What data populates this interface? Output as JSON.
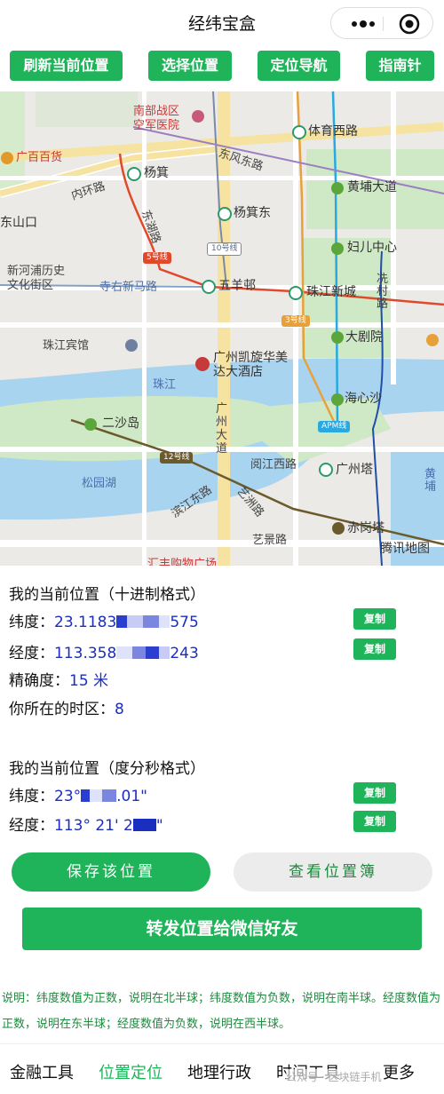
{
  "header": {
    "title": "经纬宝盒"
  },
  "top_buttons": [
    "刷新当前位置",
    "选择位置",
    "定位导航",
    "指南针"
  ],
  "map": {
    "labels": {
      "nanbu": "南部战区",
      "kongjun": "空军医院",
      "tiyu_xilu": "体育西路",
      "guangbai": "广百百货",
      "yangji": "杨箕",
      "dongfeng_donglu": "东风东路",
      "huangpu_dadao": "黄埔大道",
      "neihuanlu": "内环路",
      "dongshan": "东山口",
      "dongshan_lu": "东湖路",
      "yangjidong": "杨箕东",
      "fuer_zhongxin": "妇儿中心",
      "xinhepu": "新河浦历史",
      "wenhua_jiequ": "文化街区",
      "line5": "5号线",
      "line10": "10号线",
      "xianliu_lu": "冼村路",
      "siyou_xinmalu": "寺右新马路",
      "wuyangyi": "五羊邨",
      "zhujiang_xincheng": "珠江新城",
      "line3": "3号线",
      "zhujiang_binguan": "珠江宾馆",
      "dajuyuan": "大剧院",
      "hotel1": "广州凯旋华美",
      "hotel2": "达大酒店",
      "zhujiang": "珠江",
      "haixinsha": "海心沙",
      "ershadao": "二沙岛",
      "guangzhou_dadao": "广州大道",
      "apm": "APM线",
      "line12": "12号线",
      "yuejiang_xilu": "阅江西路",
      "guangzhouta": "广州塔",
      "songyuanhu": "松园湖",
      "binjiang_donglu": "滨江东路",
      "yizhou_donglu": "艺洲路",
      "chigangta": "赤岗塔",
      "yijing_lu": "艺景路",
      "tencent_map": "腾讯地图",
      "huipu": "汇丰购物广场",
      "huangpu_side": "黄埔"
    }
  },
  "decimal": {
    "heading": "我的当前位置（十进制格式）",
    "lat_label": "纬度：",
    "lat_prefix": "23.1183",
    "lat_suffix": "575",
    "lng_label": "经度：",
    "lng_prefix": "113.358",
    "lng_suffix": "243",
    "accuracy_label": "精确度：",
    "accuracy_value": "15 米",
    "timezone_label": "你所在的时区：",
    "timezone_value": "8",
    "copy": "复制"
  },
  "dms": {
    "heading": "我的当前位置（度分秒格式）",
    "lat_label": "纬度：",
    "lat_prefix": "23°",
    "lat_suffix": ".01\"",
    "lng_label": "经度：",
    "lng_prefix": "113° 21' 2",
    "lng_suffix": "\"",
    "copy": "复制"
  },
  "actions": {
    "save": "保存该位置",
    "view_book": "查看位置簿",
    "forward": "转发位置给微信好友"
  },
  "note": "说明：纬度数值为正数，说明在北半球；纬度数值为负数，说明在南半球。经度数值为正数，说明在东半球；经度数值为负数，说明在西半球。",
  "tabs": [
    "金融工具",
    "位置定位",
    "地理行政",
    "时间工具",
    "更多"
  ],
  "watermark": "公众号 · 区块链手机",
  "colors": {
    "primary_green": "#1fb45a",
    "value_blue": "#1a2ec0",
    "note_green": "#1d8a3e"
  }
}
